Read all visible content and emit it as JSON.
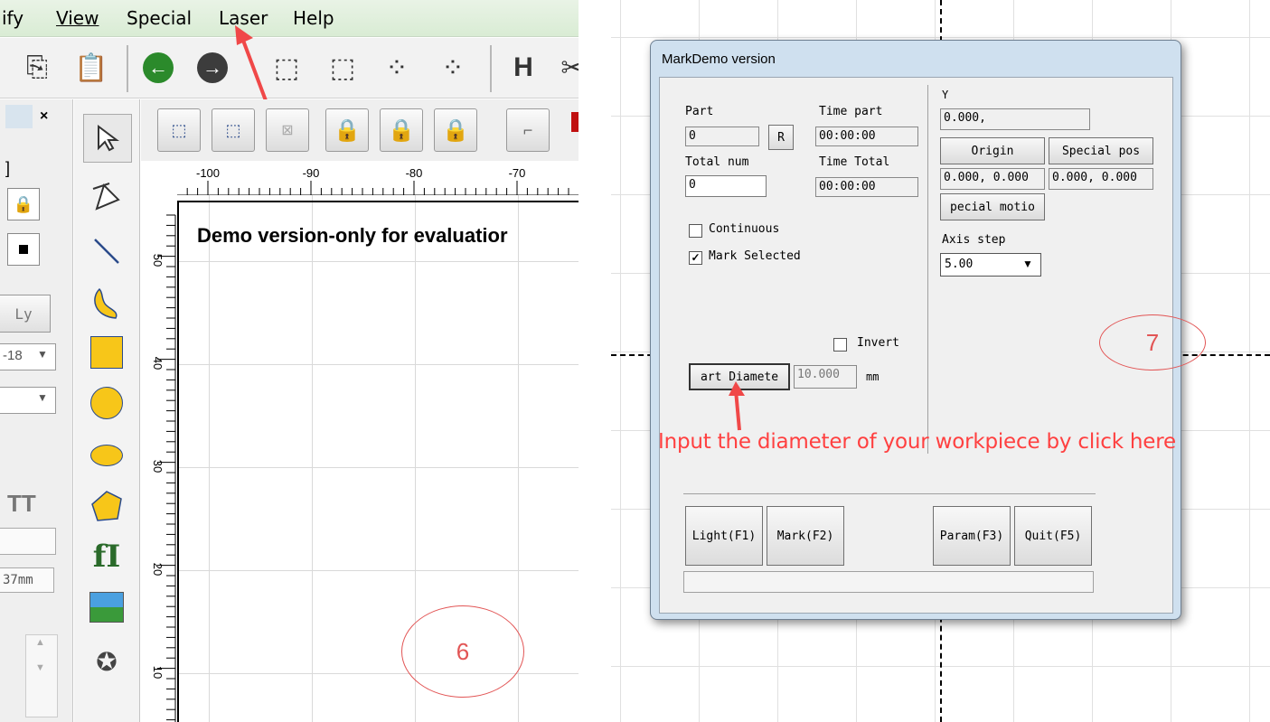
{
  "menubar": {
    "items": [
      "ify",
      "View",
      "Special",
      "Laser",
      "Help"
    ]
  },
  "left_strip": {
    "apply_label": "Ly",
    "combo_value": "-18",
    "dimension": "37mm"
  },
  "ruler": {
    "x_ticks": [
      "-100",
      "-90",
      "-80",
      "-70"
    ],
    "y_ticks": [
      "50",
      "40",
      "30",
      "20",
      "10"
    ]
  },
  "canvas": {
    "demo_text": "Demo version-only for evaluatior"
  },
  "callouts": {
    "left": "6",
    "right": "7"
  },
  "dialog": {
    "title": "MarkDemo version",
    "part_label": "Part",
    "part_value": "0",
    "r_button": "R",
    "time_part_label": "Time part",
    "time_part_value": "00:00:00",
    "total_num_label": "Total num",
    "total_num_value": "0",
    "time_total_label": "Time Total",
    "time_total_value": "00:00:00",
    "continuous_label": "Continuous",
    "continuous_checked": false,
    "mark_selected_label": "Mark Selected",
    "mark_selected_checked": true,
    "invert_label": "Invert",
    "invert_checked": false,
    "part_diameter_button": "art Diamete",
    "diameter_value": "10.000",
    "diameter_unit": "mm",
    "y_label": "Y",
    "y_value": "0.000,",
    "origin_button": "Origin",
    "special_pos_button": "Special pos",
    "origin_value": "0.000, 0.000",
    "special_pos_value": "0.000, 0.000",
    "special_motion_button": "pecial motio",
    "axis_step_label": "Axis step",
    "axis_step_value": "5.00",
    "light_button": "Light(F1)",
    "mark_button": "Mark(F2)",
    "param_button": "Param(F3)",
    "quit_button": "Quit(F5)"
  },
  "annotation": {
    "text": "Input the diameter of your workpiece by click here",
    "color": "#ff4040"
  }
}
